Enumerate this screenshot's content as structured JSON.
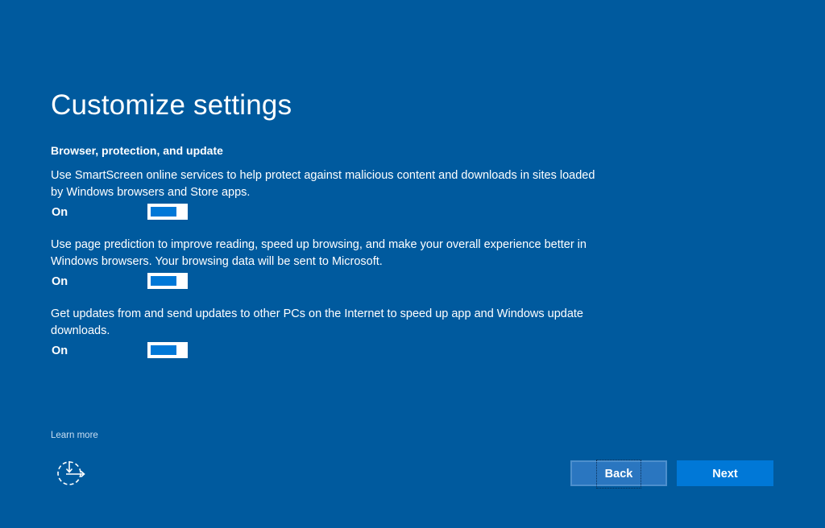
{
  "page": {
    "title": "Customize settings",
    "section_heading": "Browser, protection, and update"
  },
  "settings": [
    {
      "description": "Use SmartScreen online services to help protect against malicious content and downloads in sites loaded by Windows browsers and Store apps.",
      "state_label": "On",
      "enabled": true
    },
    {
      "description": "Use page prediction to improve reading, speed up browsing, and make your overall experience better in Windows browsers. Your browsing data will be sent to Microsoft.",
      "state_label": "On",
      "enabled": true
    },
    {
      "description": "Get updates from and send updates to other PCs on the Internet to speed up app and Windows update downloads.",
      "state_label": "On",
      "enabled": true
    }
  ],
  "footer": {
    "learn_more": "Learn more",
    "accessibility_icon": "ease-of-access-icon",
    "back_label": "Back",
    "next_label": "Next"
  },
  "colors": {
    "background": "#005a9e",
    "toggle_on": "#0078d7",
    "next_button": "#0078d7",
    "back_button": "#2a76c0"
  }
}
